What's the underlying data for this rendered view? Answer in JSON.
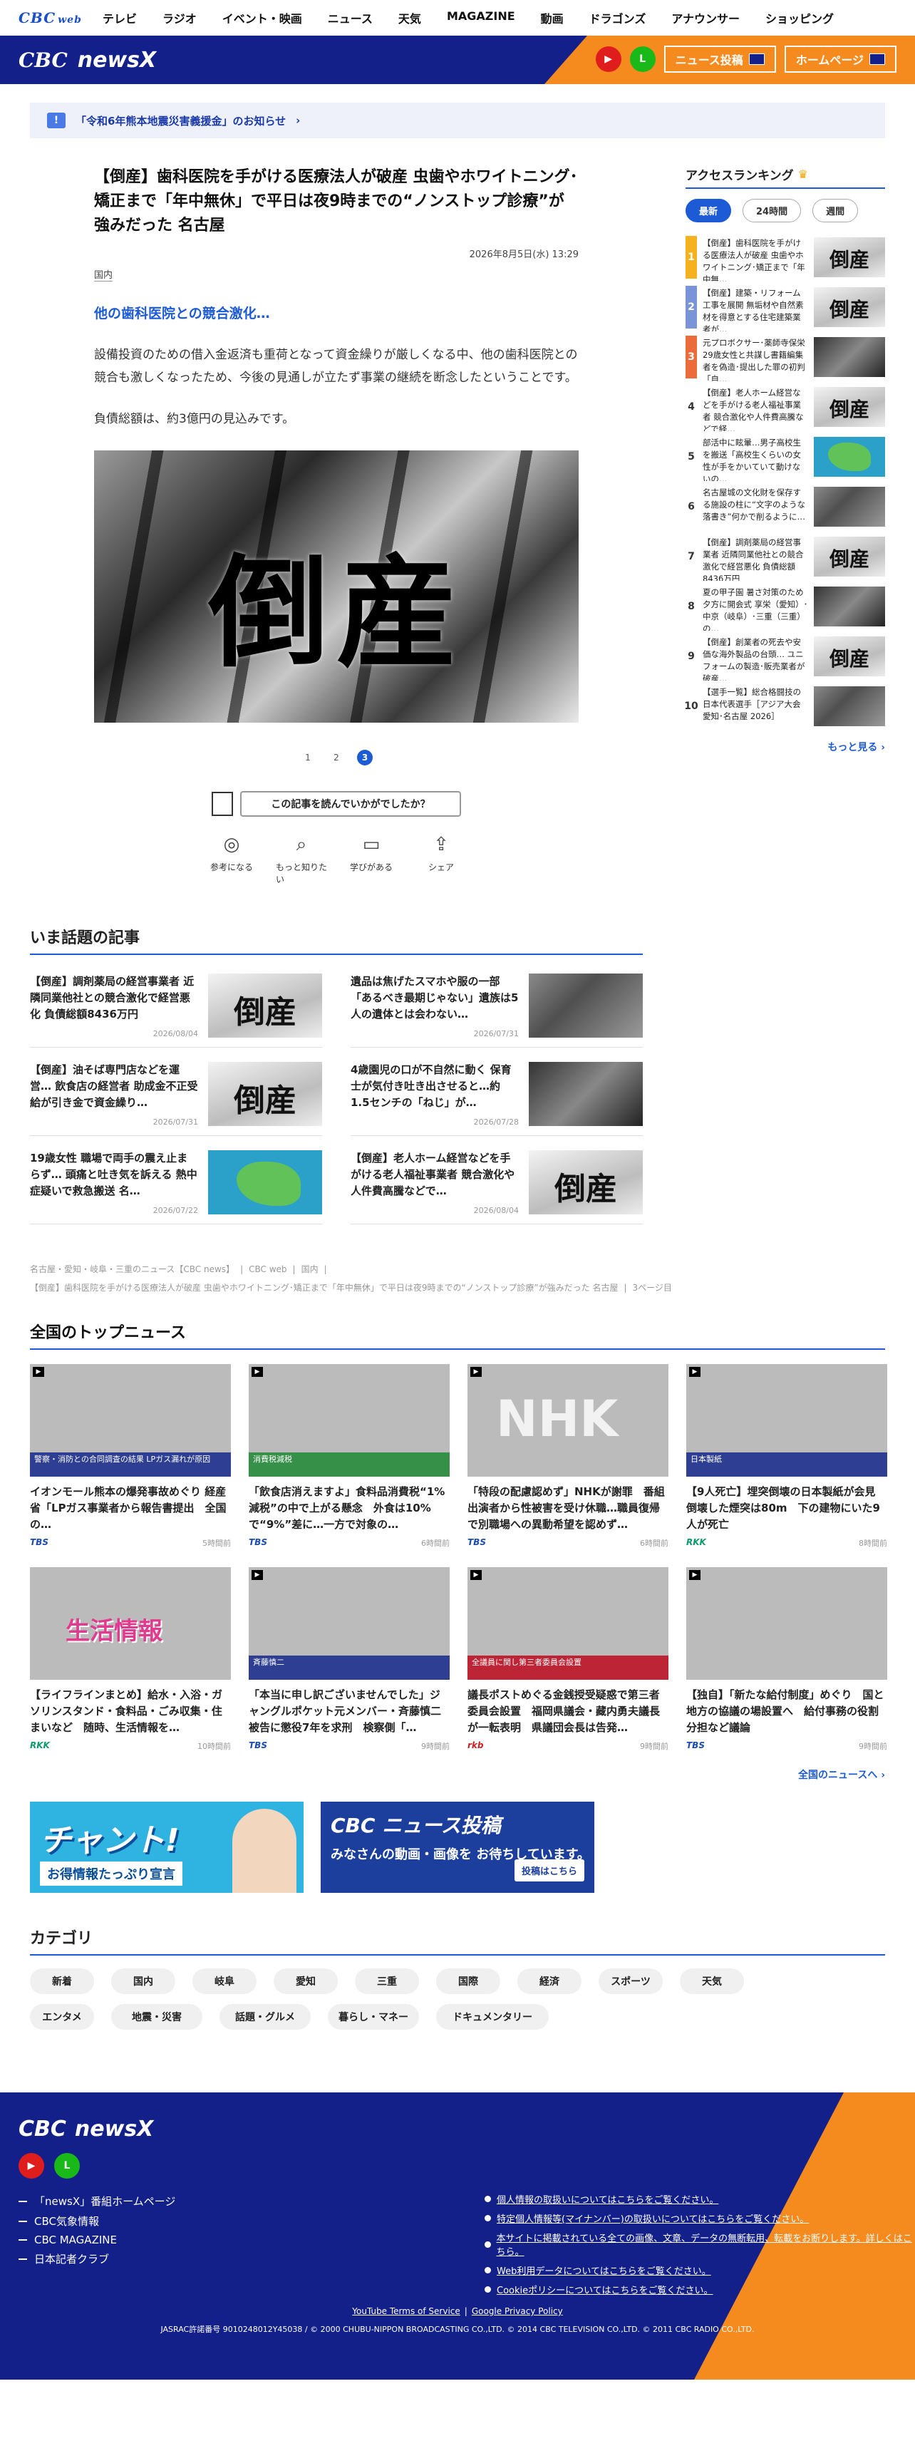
{
  "topnav": {
    "logo": "CBC",
    "logo_sub": "web",
    "items": [
      "テレビ",
      "ラジオ",
      "イベント・映画",
      "ニュース",
      "天気",
      "MAGAZINE",
      "動画",
      "ドラゴンズ",
      "アナウンサー",
      "ショッピング"
    ]
  },
  "brand": {
    "name_c": "CBC",
    "name": "newsX",
    "btn_post": "ニュース投稿",
    "btn_home": "ホームページ"
  },
  "notice": {
    "text": "「令和6年熊本地震災害義援金」のお知らせ"
  },
  "article": {
    "title": "【倒産】歯科医院を手がける医療法人が破産 虫歯やホワイトニング･矯正まで「年中無休」で平日は夜9時までの“ノンストップ診療”が強みだった 名古屋",
    "date": "2026年8月5日(水) 13:29",
    "category": "国内",
    "lead": "他の歯科医院との競合激化…",
    "body1": "設備投資のための借入金返済も重荷となって資金繰りが厳しくなる中、他の歯科医院との競合も激しくなったため、今後の見通しが立たず事業の継続を断念したということです。",
    "body2": "負債総額は、約3億円の見込みです。",
    "photo_text": "倒産",
    "pages": [
      "1",
      "2",
      "3"
    ]
  },
  "feedback": {
    "question": "この記事を読んでいかがでしたか？",
    "reactions": [
      "参考になる",
      "もっと知りたい",
      "学びがある",
      "シェア"
    ]
  },
  "trending": {
    "title": "いま話題の記事",
    "items": [
      {
        "title": "【倒産】調剤薬局の経営事業者 近隣同業他社との競合激化で経営悪化 負債総額8436万円",
        "date": "2026/08/04",
        "thumb": "倒産"
      },
      {
        "title": "遺品は焦げたスマホや服の一部「あるべき最期じゃない」遺族は5人の遺体とは会わない…",
        "date": "2026/07/31",
        "thumb": ""
      },
      {
        "title": "【倒産】油そば専門店などを運営… 飲食店の経営者 助成金不正受給が引き金で資金繰り…",
        "date": "2026/07/31",
        "thumb": "倒産"
      },
      {
        "title": "4歳園児の口が不自然に動く 保育士が気付き吐き出させると…約1.5センチの「ねじ」が…",
        "date": "2026/07/28",
        "thumb": ""
      },
      {
        "title": "19歳女性 職場で両手の震え止まらず… 頭痛と吐き気を訴える 熱中症疑いで救急搬送 名…",
        "date": "2026/07/22",
        "thumb": ""
      },
      {
        "title": "【倒産】老人ホーム経営などを手がける老人福祉事業者 競合激化や人件費高騰などで…",
        "date": "2026/08/04",
        "thumb": "倒産"
      }
    ]
  },
  "breadcrumbs": [
    "名古屋・愛知・岐阜・三重のニュース【CBC news】",
    "CBC web",
    "国内",
    "【倒産】歯科医院を手がける医療法人が破産 虫歯やホワイトニング･矯正まで「年中無休」で平日は夜9時までの“ノンストップ診療”が強みだった 名古屋",
    "3ページ目"
  ],
  "ranking": {
    "title": "アクセスランキング",
    "tabs": [
      "最新",
      "24時間",
      "週間"
    ],
    "items": [
      {
        "n": "1",
        "text": "【倒産】歯科医院を手がける医療法人が破産 虫歯やホワイトニング･矯正まで「年中無…",
        "thumb": "倒産"
      },
      {
        "n": "2",
        "text": "【倒産】建築・リフォーム工事を展開 無垢材や自然素材を得意とする住宅建築業者が…",
        "thumb": "倒産"
      },
      {
        "n": "3",
        "text": "元プロボクサー･薬師寺保栄 29歳女性と共謀し書籍編集者を偽造･提出した罪の初判「自…",
        "thumb": ""
      },
      {
        "n": "4",
        "text": "【倒産】老人ホーム経営などを手がける老人福祉事業者 競合激化や人件費高騰などで経…",
        "thumb": "倒産"
      },
      {
        "n": "5",
        "text": "部活中に眩暈…男子高校生を搬送「高校生くらいの女性が手をかいていて動けないの…",
        "thumb": ""
      },
      {
        "n": "6",
        "text": "名古屋城の文化財を保存する施設の柱に“文字のような落書き”何かで削るように…",
        "thumb": ""
      },
      {
        "n": "7",
        "text": "【倒産】調剤薬局の経営事業者 近隣同業他社との競合激化で経営悪化 負債総額8436万円",
        "thumb": "倒産"
      },
      {
        "n": "8",
        "text": "夏の甲子園 暑さ対策のため夕方に開会式 享栄（愛知）･中京（岐阜）･三重（三重）の…",
        "thumb": ""
      },
      {
        "n": "9",
        "text": "【倒産】創業者の死去や安価な海外製品の台頭… ユニフォームの製造･販売業者が破産…",
        "thumb": "倒産"
      },
      {
        "n": "10",
        "text": "【選手一覧】総合格闘技の日本代表選手［アジア大会 愛知･名古屋 2026］",
        "thumb": ""
      }
    ],
    "more": "もっと見る"
  },
  "topnews": {
    "title": "全国のトップニュース",
    "items": [
      {
        "title": "イオンモール熊本の爆発事故めぐり 経産省「LPガス事業者から報告書提出　全国の…",
        "src": "TBS",
        "age": "5時間前",
        "cap": "警察・消防との合同調査の結果 LPガス漏れが原因"
      },
      {
        "title": "「飲食店消えますよ」食料品消費税“1%減税”の中で上がる懸念　外食は10%で“9%”差に…一方で対象の…",
        "src": "TBS",
        "age": "6時間前",
        "cap": "消費税減税"
      },
      {
        "title": "「特段の配慮認めず」NHKが謝罪　番組出演者から性被害を受け休職…職員復帰で別職場への異動希望を認めず…",
        "src": "TBS",
        "age": "6時間前",
        "cap": "NHK"
      },
      {
        "title": "【9人死亡】埋突倒壊の日本製紙が会見 倒壊した煙突は80m　下の建物にいた9人が死亡",
        "src": "RKK",
        "age": "8時間前",
        "cap": "日本製紙"
      },
      {
        "title": "【ライフラインまとめ】給水・入浴・ガソリンスタンド・食料品・ごみ収集・住まいなど　随時、生活情報を…",
        "src": "RKK",
        "age": "10時間前",
        "cap": "生活情報"
      },
      {
        "title": "「本当に申し訳ございませんでした」ジャングルポケット元メンバー・斉藤慎二被告に懲役7年を求刑　検察側「…",
        "src": "TBS",
        "age": "9時間前",
        "cap": "斉藤慎二"
      },
      {
        "title": "議長ポストめぐる金銭授受疑惑で第三者委員会設置　福岡県議会・藏内勇夫議長が一転表明　県議団会長は告発…",
        "src": "rkb",
        "age": "9時間前",
        "cap": "全議員に関し第三者委員会設置"
      },
      {
        "title": "【独自】「新たな給付制度」めぐり　国と地方の協議の場設置へ　給付事務の役割分担など議論",
        "src": "TBS",
        "age": "9時間前",
        "cap": ""
      }
    ],
    "more": "全国のニュースへ"
  },
  "banners": {
    "b1_title": "チャント!",
    "b1_sub": "お得情報たっぷり宣言",
    "b2_title": "CBC ニュース投稿",
    "b2_sub": "みなさんの動画・画像を お待ちしています。",
    "b2_btn": "投稿はこちら"
  },
  "categories": {
    "title": "カテゴリ",
    "items": [
      "新着",
      "国内",
      "岐阜",
      "愛知",
      "三重",
      "国際",
      "経済",
      "スポーツ",
      "天気",
      "エンタメ",
      "地震・災害",
      "話題・グルメ",
      "暮らし・マネー",
      "ドキュメンタリー"
    ]
  },
  "footer": {
    "brand_c": "CBC",
    "brand": "newsX",
    "links": [
      "「newsX」番組ホームページ",
      "CBC気象情報",
      "CBC MAGAZINE",
      "日本記者クラブ"
    ],
    "policies": [
      "個人情報の取扱いについてはこちらをご覧ください。",
      "特定個人情報等(マイナンバー)の取扱いについてはこちらをご覧ください。",
      "本サイトに掲載されている全ての画像、文章、データの無断転用、転載をお断りします。詳しくはこちら。",
      "Web利用データについてはこちらをご覧ください。",
      "Cookieポリシーについてはこちらをご覧ください。"
    ],
    "yt_terms": "YouTube Terms of Service",
    "privacy": "Google Privacy Policy",
    "copyright": "JASRAC許諾番号 9010248012Y45038 / © 2000 CHUBU-NIPPON BROADCASTING CO.,LTD. © 2014 CBC TELEVISION CO.,LTD. © 2011 CBC RADIO CO.,LTD."
  }
}
